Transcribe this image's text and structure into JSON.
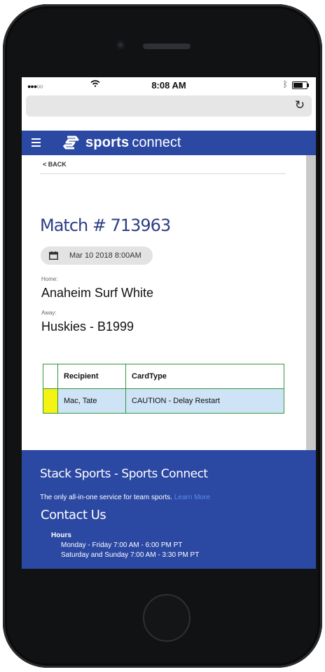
{
  "status": {
    "time": "8:08 AM",
    "signal": "●●●○○"
  },
  "header": {
    "brand_bold": "sports",
    "brand_light": "connect"
  },
  "nav": {
    "back_label": "< BACK"
  },
  "match": {
    "title": "Match # 713963",
    "date": "Mar 10 2018 8:00AM",
    "home_label": "Home:",
    "home_team": "Anaheim Surf White",
    "away_label": "Away:",
    "away_team": "Huskies - B1999"
  },
  "cards_table": {
    "headers": [
      "",
      "Recipient",
      "CardType"
    ],
    "rows": [
      {
        "card_color": "#f5f313",
        "recipient": "Mac, Tate",
        "card_type": "CAUTION - Delay Restart"
      }
    ]
  },
  "footer": {
    "title": "Stack Sports - Sports Connect",
    "tagline": "The only all-in-one service for team sports.",
    "learn_more": "Learn More",
    "contact_title": "Contact Us",
    "hours_label": "Hours",
    "hours_weekday": "Monday - Friday 7:00 AM - 6:00 PM PT",
    "hours_weekend": "Saturday and Sunday 7:00 AM - 3:30 PM PT"
  },
  "colors": {
    "brand_blue": "#2b48a2",
    "table_border": "#2e9a3b",
    "row_bg": "#cfe3f6",
    "yellow_card": "#f5f313",
    "link": "#5b8df0"
  },
  "toolbar": {
    "icons": [
      "back-arrow-icon",
      "forward-arrow-icon",
      "share-icon",
      "bookmarks-icon",
      "tabs-icon"
    ]
  }
}
